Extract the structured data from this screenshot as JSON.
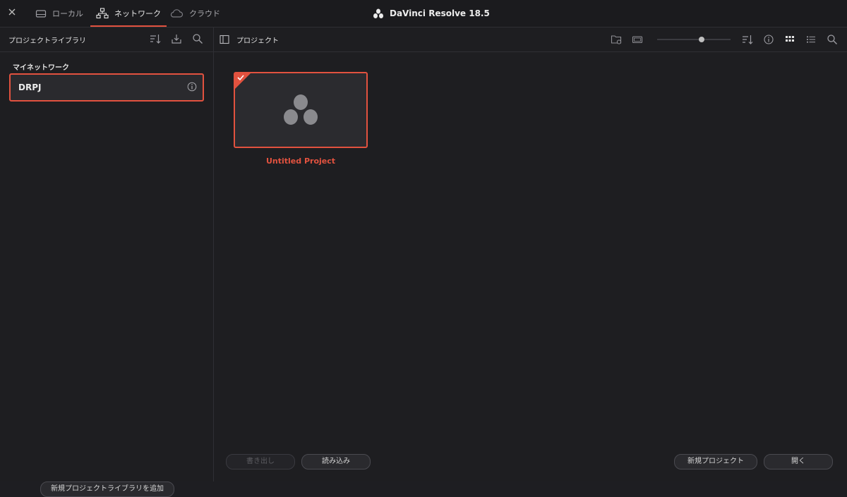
{
  "topbar": {
    "tabs": [
      {
        "label": "ローカル",
        "icon": "drive-icon"
      },
      {
        "label": "ネットワーク",
        "icon": "network-icon",
        "active": true
      },
      {
        "label": "クラウド",
        "icon": "cloud-icon"
      }
    ],
    "app_title": "DaVinci Resolve 18.5"
  },
  "left_panel": {
    "title": "プロジェクトライブラリ",
    "section_label": "マイネットワーク",
    "libraries": [
      {
        "name": "DRPJ",
        "selected": true
      }
    ],
    "add_library_label": "新規プロジェクトライブラリを追加"
  },
  "right_panel": {
    "title": "プロジェクト",
    "projects": [
      {
        "name": "Untitled Project",
        "selected": true
      }
    ],
    "export_label": "書き出し",
    "import_label": "読み込み",
    "new_project_label": "新規プロジェクト",
    "open_label": "開く"
  },
  "colors": {
    "accent": "#e2523f",
    "background": "#1e1e21"
  }
}
